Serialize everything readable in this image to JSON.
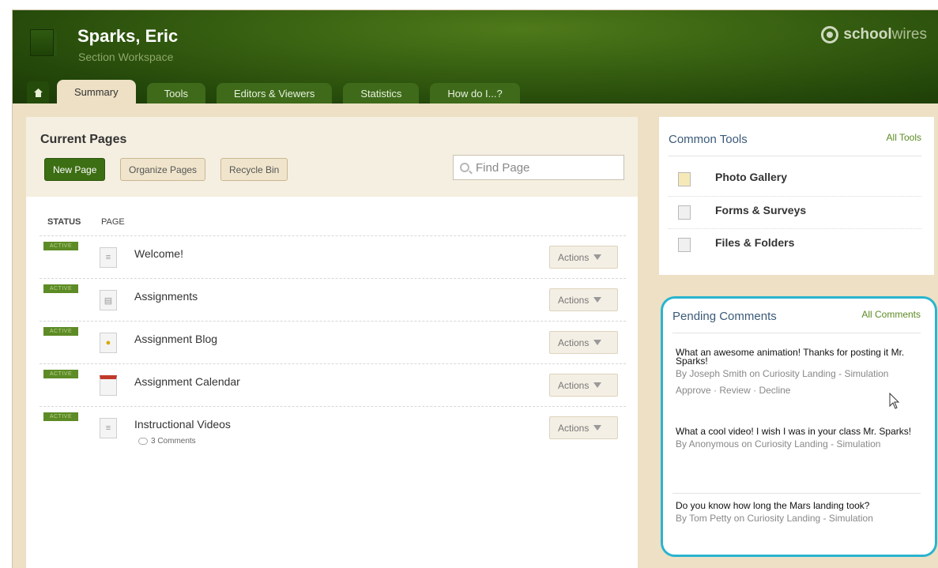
{
  "header": {
    "title": "Sparks, Eric",
    "subtitle": "Section Workspace",
    "brand_bold": "school",
    "brand_light": "wires"
  },
  "tabs": [
    {
      "label": "Summary"
    },
    {
      "label": "Tools"
    },
    {
      "label": "Editors & Viewers"
    },
    {
      "label": "Statistics"
    },
    {
      "label": "How do I...?"
    }
  ],
  "main": {
    "title": "Current Pages",
    "buttons": {
      "new_page": "New Page",
      "organize": "Organize Pages",
      "recycle": "Recycle Bin"
    },
    "find_placeholder": "Find Page",
    "columns": {
      "status": "STATUS",
      "page": "PAGE"
    },
    "rows": [
      {
        "status": "ACTIVE",
        "name": "Welcome!",
        "actions": "Actions"
      },
      {
        "status": "ACTIVE",
        "name": "Assignments",
        "actions": "Actions"
      },
      {
        "status": "ACTIVE",
        "name": "Assignment Blog",
        "actions": "Actions"
      },
      {
        "status": "ACTIVE",
        "name": "Assignment Calendar",
        "actions": "Actions"
      },
      {
        "status": "ACTIVE",
        "name": "Instructional Videos",
        "actions": "Actions",
        "comments": "3 Comments"
      }
    ]
  },
  "common_tools": {
    "title": "Common Tools",
    "link": "All Tools",
    "items": [
      "Photo Gallery",
      "Forms & Surveys",
      "Files & Folders"
    ]
  },
  "pending": {
    "title": "Pending Comments",
    "link": "All Comments",
    "comments": [
      {
        "text": "What an awesome animation! Thanks for posting it Mr. Sparks!",
        "by": "By Joseph Smith on Curiosity Landing - Simulation",
        "actions": [
          "Approve",
          "Review",
          "Decline"
        ]
      },
      {
        "text": "What a cool video! I wish I was in your class Mr. Sparks!",
        "by": "By Anonymous on Curiosity Landing - Simulation"
      },
      {
        "text": "Do you know how long the Mars landing took?",
        "by": "By Tom Petty on Curiosity Landing - Simulation"
      }
    ]
  }
}
